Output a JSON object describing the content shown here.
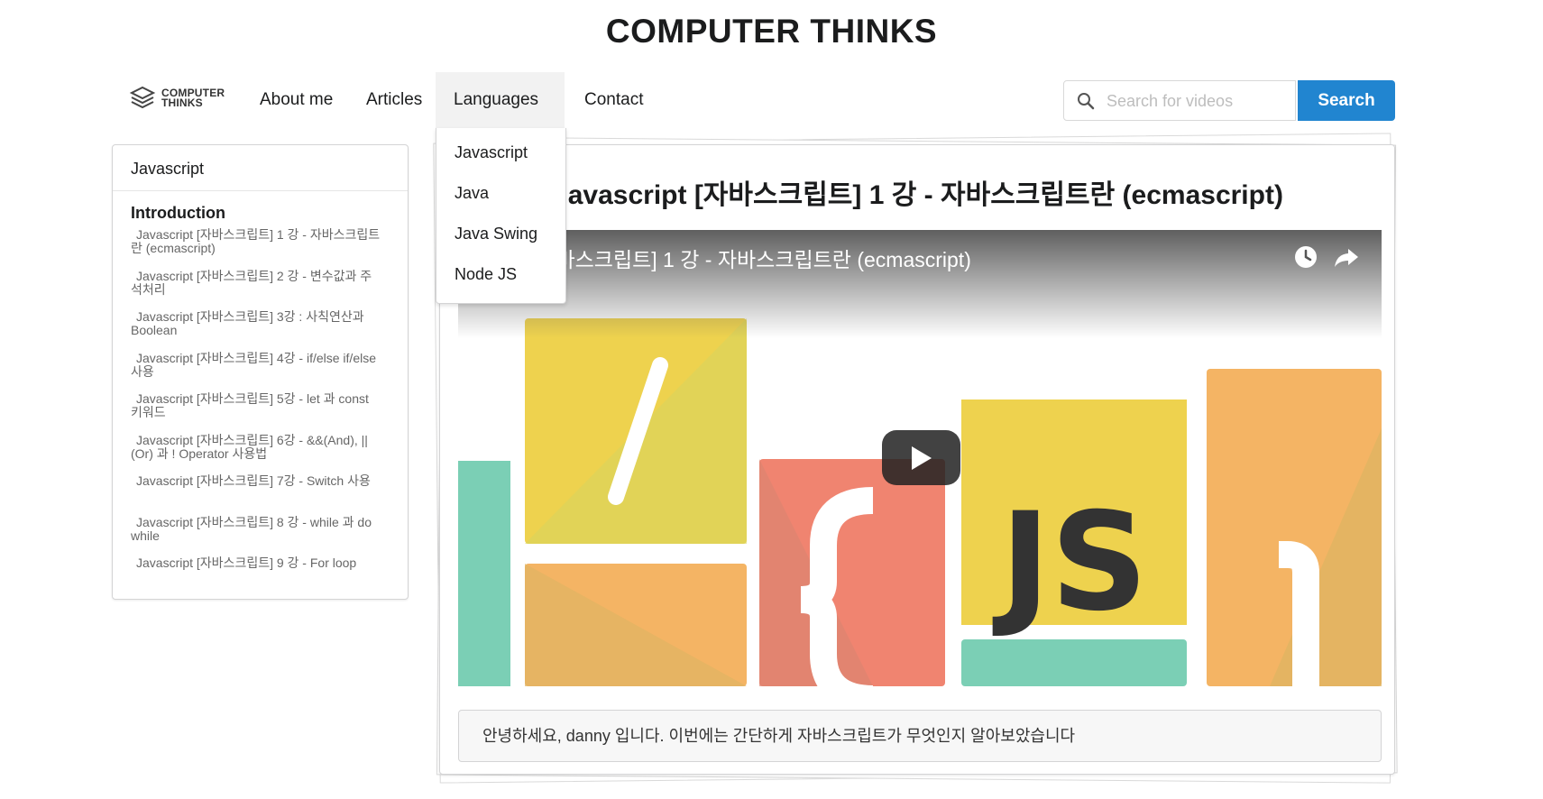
{
  "site": {
    "title": "COMPUTER THINKS"
  },
  "logo": {
    "line1": "COMPUTER",
    "line2": "THINKS"
  },
  "nav": {
    "items": [
      {
        "label": "About me"
      },
      {
        "label": "Articles"
      },
      {
        "label": "Languages",
        "active": true
      },
      {
        "label": "Contact"
      }
    ]
  },
  "dropdown": {
    "items": [
      "Javascript",
      "Java",
      "Java Swing",
      "Node JS"
    ]
  },
  "search": {
    "placeholder": "Search for videos",
    "value": "",
    "button": "Search"
  },
  "sidebar": {
    "header": "Javascript",
    "section": "Introduction",
    "lessons": [
      "Javascript [자바스크립트] 1 강 - 자바스크립트란 (ecmascript)",
      "Javascript [자바스크립트] 2 강 - 변수값과 주석처리",
      "Javascript [자바스크립트] 3강 : 사칙연산과 Boolean",
      "Javascript [자바스크립트] 4강 - if/else if/else 사용",
      "Javascript [자바스크립트] 5강 - let 과 const 키워드",
      "Javascript [자바스크립트] 6강 - &&(And), || (Or) 과 ! Operator 사용법",
      "Javascript [자바스크립트] 7강 - Switch 사용",
      "Javascript [자바스크립트] 8 강 - while 과 do while",
      "Javascript [자바스크립트] 9 강 - For loop"
    ]
  },
  "post": {
    "title": "Javascript [자바스크립트] 1 강 - 자바스크립트란 (ecmascript)",
    "video_title": "Javascript [자바스크립트] 1 강 - 자바스크립트란 (ecmascript)",
    "thumbnail_text": "JS",
    "description": "안녕하세요, danny 입니다. 이번에는 간단하게 자바스크립트가 무엇인지 알아보았습니다"
  },
  "colors": {
    "accent": "#2185d0",
    "yellow": "#eed24e",
    "coral": "#f08470",
    "orange": "#f4b464",
    "teal": "#7bcfb5"
  }
}
